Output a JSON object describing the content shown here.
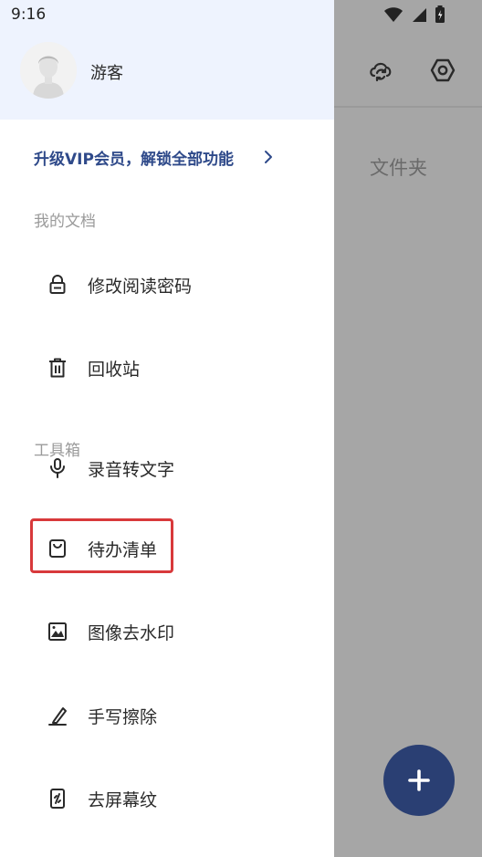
{
  "status": {
    "time": "9:16"
  },
  "background": {
    "folder_label": "文件夹",
    "fab_label": "+"
  },
  "drawer": {
    "user": {
      "name": "游客"
    },
    "vip_promo": "升级VIP会员，解锁全部功能",
    "sections": {
      "my_docs": "我的文档",
      "toolbox": "工具箱"
    },
    "items": {
      "change_password": "修改阅读密码",
      "recycle_bin": "回收站",
      "audio_to_text": "录音转文字",
      "todo_list": "待办清单",
      "watermark_removal": "图像去水印",
      "handwriting_erase": "手写擦除",
      "moire_removal": "去屏幕纹"
    }
  },
  "colors": {
    "accent": "#2f4a8a",
    "fab": "#2a3f73",
    "highlight": "#d8393b"
  }
}
